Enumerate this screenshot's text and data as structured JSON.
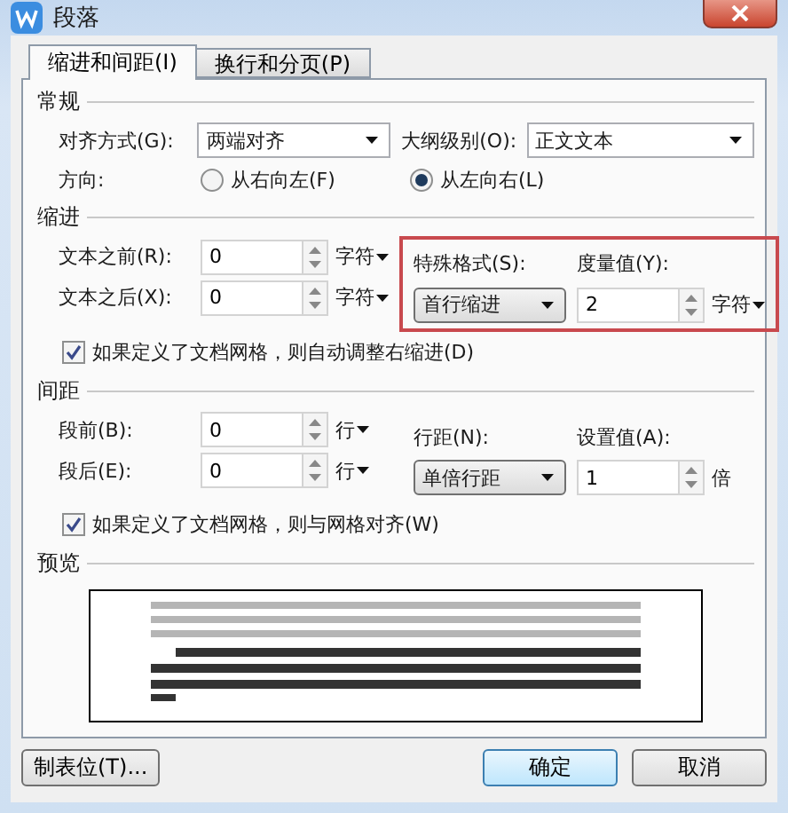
{
  "window": {
    "title": "段落"
  },
  "tabs": [
    {
      "label": "缩进和间距(I)",
      "selected": true
    },
    {
      "label": "换行和分页(P)",
      "selected": false
    }
  ],
  "general": {
    "heading": "常规",
    "alignment": {
      "label": "对齐方式(G):",
      "value": "两端对齐"
    },
    "outline_level": {
      "label": "大纲级别(O):",
      "value": "正文文本"
    },
    "direction": {
      "label": "方向:",
      "options": [
        {
          "label": "从右向左(F)",
          "selected": false
        },
        {
          "label": "从左向右(L)",
          "selected": true
        }
      ]
    }
  },
  "indent": {
    "heading": "缩进",
    "before": {
      "label": "文本之前(R):",
      "value": "0",
      "unit": "字符",
      "unit_menu": true
    },
    "after": {
      "label": "文本之后(X):",
      "value": "0",
      "unit": "字符",
      "unit_menu": true
    },
    "special": {
      "label": "特殊格式(S):",
      "value": "首行缩进"
    },
    "measure": {
      "label": "度量值(Y):",
      "value": "2",
      "unit": "字符",
      "unit_menu": true
    },
    "highlighted": true,
    "auto_adjust": {
      "label": "如果定义了文档网格，则自动调整右缩进(D)",
      "checked": true
    }
  },
  "spacing": {
    "heading": "间距",
    "before": {
      "label": "段前(B):",
      "value": "0",
      "unit": "行",
      "unit_menu": true
    },
    "after": {
      "label": "段后(E):",
      "value": "0",
      "unit": "行",
      "unit_menu": true
    },
    "line_spacing": {
      "label": "行距(N):",
      "value": "单倍行距"
    },
    "setting": {
      "label": "设置值(A):",
      "value": "1",
      "unit": "倍",
      "unit_menu": false
    },
    "highlighted": false,
    "snap_to_grid": {
      "label": "如果定义了文档网格，则与网格对齐(W)",
      "checked": true
    }
  },
  "preview": {
    "heading": "预览"
  },
  "buttons": [
    {
      "label": "制表位(T)...",
      "kind": "normal"
    },
    {
      "label": "确定",
      "kind": "default"
    },
    {
      "label": "取消",
      "kind": "normal"
    }
  ]
}
